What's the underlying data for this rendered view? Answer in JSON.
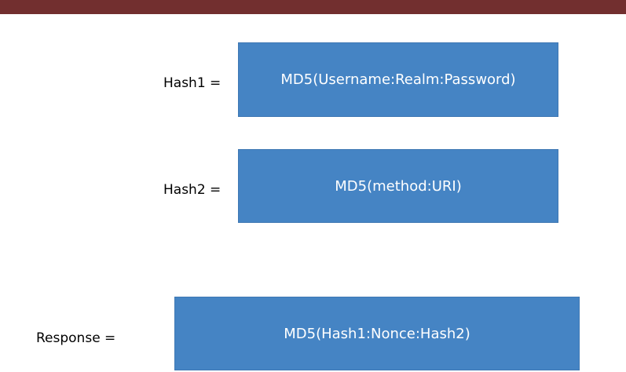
{
  "colors": {
    "top_bar": "#722f2f",
    "box_fill": "#4584c4",
    "box_text": "#ffffff",
    "label_text": "#000000"
  },
  "rows": {
    "hash1": {
      "label": "Hash1 =",
      "formula": "MD5(Username:Realm:Password)"
    },
    "hash2": {
      "label": "Hash2 =",
      "formula": "MD5(method:URI)"
    },
    "response": {
      "label": "Response =",
      "formula": "MD5(Hash1:Nonce:Hash2)"
    }
  }
}
